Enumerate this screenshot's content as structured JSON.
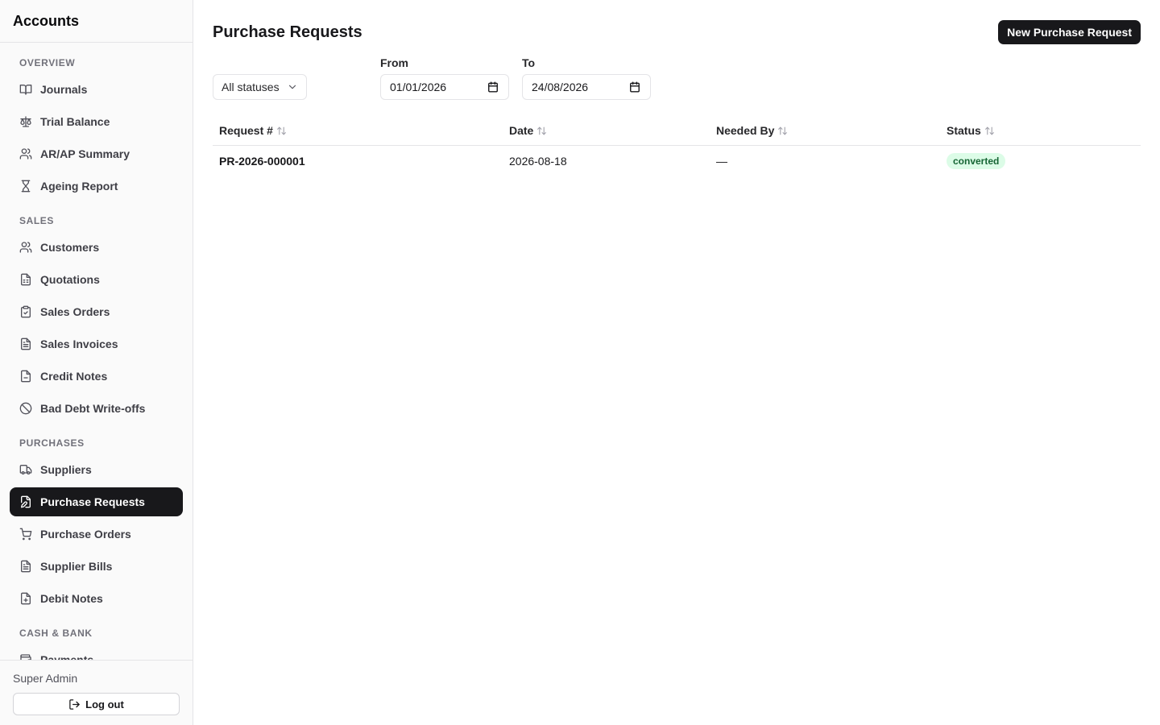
{
  "app": {
    "title": "Accounts"
  },
  "sidebar": {
    "sections": [
      {
        "label": "OVERVIEW",
        "items": [
          {
            "label": "Journals",
            "icon": "book-open-icon"
          },
          {
            "label": "Trial Balance",
            "icon": "scale-icon"
          },
          {
            "label": "AR/AP Summary",
            "icon": "users-icon"
          },
          {
            "label": "Ageing Report",
            "icon": "hourglass-icon"
          }
        ]
      },
      {
        "label": "SALES",
        "items": [
          {
            "label": "Customers",
            "icon": "users-icon"
          },
          {
            "label": "Quotations",
            "icon": "file-spreadsheet-icon"
          },
          {
            "label": "Sales Orders",
            "icon": "clipboard-check-icon"
          },
          {
            "label": "Sales Invoices",
            "icon": "file-text-icon"
          },
          {
            "label": "Credit Notes",
            "icon": "file-minus-icon"
          },
          {
            "label": "Bad Debt Write-offs",
            "icon": "ban-icon"
          }
        ]
      },
      {
        "label": "PURCHASES",
        "items": [
          {
            "label": "Suppliers",
            "icon": "truck-icon"
          },
          {
            "label": "Purchase Requests",
            "icon": "file-pen-icon",
            "active": true
          },
          {
            "label": "Purchase Orders",
            "icon": "shopping-cart-icon"
          },
          {
            "label": "Supplier Bills",
            "icon": "receipt-icon"
          },
          {
            "label": "Debit Notes",
            "icon": "file-plus-icon"
          }
        ]
      },
      {
        "label": "CASH & BANK",
        "items": [
          {
            "label": "Payments",
            "icon": "wallet-icon"
          }
        ]
      }
    ],
    "footer": {
      "user_name": "Super Admin",
      "logout_label": "Log out"
    }
  },
  "main": {
    "title": "Purchase Requests",
    "new_button_label": "New Purchase Request",
    "filters": {
      "status_value": "All statuses",
      "from_label": "From",
      "from_value": "01/01/2026",
      "to_label": "To",
      "to_value": "24/08/2026"
    },
    "table": {
      "columns": [
        "Request #",
        "Date",
        "Needed By",
        "Status"
      ],
      "rows": [
        {
          "request_no": "PR-2026-000001",
          "date": "2026-08-18",
          "needed_by": "—",
          "status": "converted"
        }
      ]
    }
  },
  "colors": {
    "active_bg": "#18181b",
    "badge_bg": "#dcfce7",
    "badge_text": "#166534"
  }
}
